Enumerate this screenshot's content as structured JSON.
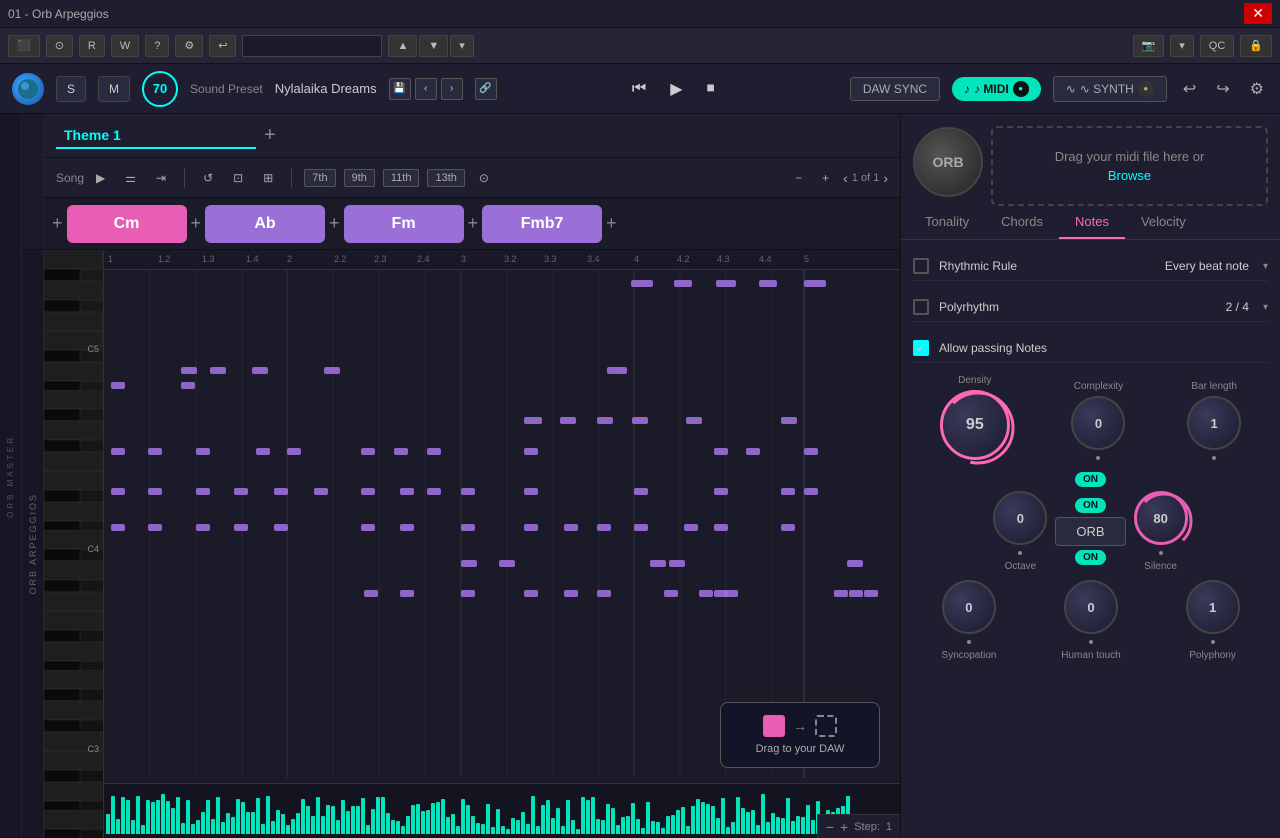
{
  "titlebar": {
    "title": "01 - Orb Arpeggios",
    "close": "✕"
  },
  "toolbar": {
    "r_btn": "R",
    "w_btn": "W",
    "btn3": "?",
    "qc": "QC"
  },
  "header": {
    "s_btn": "S",
    "m_btn": "M",
    "bpm": "70",
    "sound_preset_label": "Sound Preset",
    "sound_preset_name": "Nylalaika Dreams",
    "daw_sync": "DAW SYNC",
    "midi_btn": "♪ MIDI",
    "synth_btn": "∿ SYNTH"
  },
  "theme": {
    "name": "Theme 1",
    "add_btn": "+"
  },
  "controls": {
    "song_label": "Song",
    "seventh": "7th",
    "ninth": "9th",
    "eleventh": "11th",
    "thirteenth": "13th",
    "page": "1 of 1"
  },
  "chords": [
    {
      "name": "Cm",
      "style": "pink"
    },
    {
      "name": "Ab",
      "style": "purple"
    },
    {
      "name": "Fm",
      "style": "purple"
    },
    {
      "name": "Fmb7",
      "style": "purple"
    }
  ],
  "ruler": {
    "marks": [
      "1",
      "1.2",
      "1.3",
      "1.4",
      "2",
      "2.2",
      "2.3",
      "2.4",
      "3",
      "3.2",
      "3.3",
      "3.4",
      "4",
      "4.2",
      "4.3",
      "4.4",
      "5"
    ]
  },
  "piano_notes": [
    {
      "label": "C5",
      "top_pct": 17
    },
    {
      "label": "C4",
      "top_pct": 52
    },
    {
      "label": "C3",
      "top_pct": 87
    }
  ],
  "midi_drop": {
    "text": "Drag your midi file here or",
    "browse": "Browse"
  },
  "orb_circle": "ORB",
  "panel_tabs": [
    {
      "name": "Tonality",
      "active": false
    },
    {
      "name": "Chords",
      "active": false
    },
    {
      "name": "Notes",
      "active": true
    },
    {
      "name": "Velocity",
      "active": false
    }
  ],
  "panel": {
    "rhythmic_rule_label": "Rhythmic Rule",
    "rhythmic_rule_value": "Every beat note",
    "polyrhythm_label": "Polyrhythm",
    "polyrhythm_value": "2 / 4",
    "allow_passing_label": "Allow passing Notes",
    "density_label": "Density",
    "density_value": "95",
    "complexity_label": "Complexity",
    "complexity_value": "0",
    "bar_length_label": "Bar length",
    "bar_length_value": "1",
    "on_badge1": "ON",
    "orb_btn": "ORB",
    "on_badge2": "ON",
    "octave_label": "Octave",
    "octave_value": "0",
    "silence_label": "Silence",
    "silence_value": "80",
    "syncopation_label": "Syncopation",
    "syncopation_value": "0",
    "human_touch_label": "Human touch",
    "human_touch_value": "0",
    "polyphony_label": "Polyphony",
    "polyphony_value": "1"
  },
  "drag_to_daw": {
    "label": "Drag to your DAW"
  },
  "step_controls": {
    "minus": "−",
    "plus": "+",
    "step_label": "Step:",
    "step_value": "1"
  },
  "orb_arpeggios_label": "ORB ARPEGGIOS",
  "orb_master_label": "ORB MASTER"
}
